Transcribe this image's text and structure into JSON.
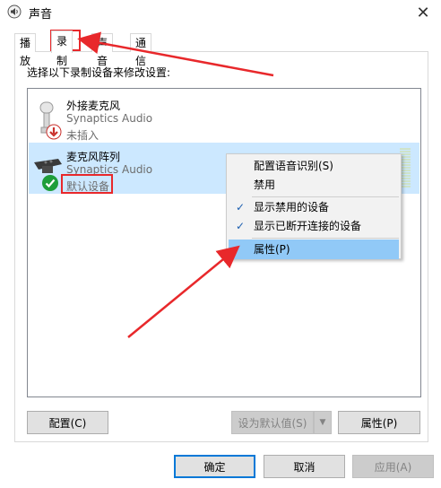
{
  "window": {
    "title": "声音",
    "close_symbol": "✕"
  },
  "tabs": [
    {
      "label": "播放",
      "active": false
    },
    {
      "label": "录制",
      "active": true
    },
    {
      "label": "声音",
      "active": false
    },
    {
      "label": "通信",
      "active": false
    }
  ],
  "instruction": "选择以下录制设备来修改设置:",
  "devices": [
    {
      "name": "外接麦克风",
      "driver": "Synaptics Audio",
      "status": "未插入",
      "icon": "external-mic-icon",
      "status_badge": "unplugged-arrow-icon",
      "selected": false
    },
    {
      "name": "麦克风阵列",
      "driver": "Synaptics Audio",
      "status": "默认设备",
      "icon": "mic-array-icon",
      "status_badge": "default-check-icon",
      "selected": true
    }
  ],
  "context_menu": {
    "items": [
      {
        "label": "配置语音识别(S)",
        "checked": false,
        "highlighted": false
      },
      {
        "label": "禁用",
        "checked": false,
        "highlighted": false
      },
      {
        "label": "显示禁用的设备",
        "checked": true,
        "highlighted": false
      },
      {
        "label": "显示已断开连接的设备",
        "checked": true,
        "highlighted": false
      },
      {
        "label": "属性(P)",
        "checked": false,
        "highlighted": true
      }
    ],
    "check_symbol": "✓"
  },
  "panel_buttons": {
    "configure": "配置(C)",
    "set_default": "设为默认值(S)",
    "set_default_arrow": "▼",
    "properties": "属性(P)"
  },
  "dialog_buttons": {
    "ok": "确定",
    "cancel": "取消",
    "apply": "应用(A)"
  },
  "colors": {
    "selection": "#cce8ff",
    "menu_highlight": "#91c9f7",
    "annotation_red": "#e8282b",
    "default_check_green": "#1e9e3a",
    "primary_border": "#0078d7"
  }
}
